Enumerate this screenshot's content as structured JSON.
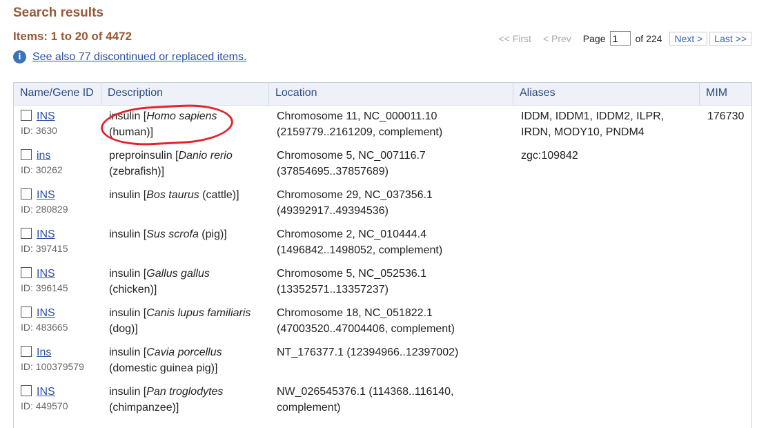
{
  "header": {
    "title": "Search results",
    "items_label": "Items: 1 to 20 of 4472"
  },
  "pager": {
    "first": "<< First",
    "prev": "< Prev",
    "page_label": "Page",
    "page_value": "1",
    "of_label": "of 224",
    "next": "Next >",
    "last": "Last >>"
  },
  "info": {
    "icon": "info-icon",
    "link_text": "See also 77 discontinued or replaced items."
  },
  "table": {
    "columns": [
      "Name/Gene ID",
      "Description",
      "Location",
      "Aliases",
      "MIM"
    ],
    "rows": [
      {
        "name": "INS",
        "id": "ID: 3630",
        "desc_pre": "insulin [",
        "desc_sp": "Homo sapiens",
        "desc_post": "",
        "desc_line2": "(human)]",
        "loc1": "Chromosome 11, NC_000011.10",
        "loc2": "(2159779..2161209, complement)",
        "alias1": "IDDM, IDDM1, IDDM2, ILPR,",
        "alias2": "IRDN, MODY10, PNDM4",
        "mim": "176730"
      },
      {
        "name": "ins",
        "id": "ID: 30262",
        "desc_pre": "preproinsulin [",
        "desc_sp": "Danio rerio",
        "desc_post": "",
        "desc_line2": "(zebrafish)]",
        "loc1": "Chromosome 5, NC_007116.7",
        "loc2": "(37854695..37857689)",
        "alias1": "zgc:109842",
        "alias2": "",
        "mim": ""
      },
      {
        "name": "INS",
        "id": "ID: 280829",
        "desc_pre": "insulin [",
        "desc_sp": "Bos taurus",
        "desc_post": " (cattle)]",
        "desc_line2": "",
        "loc1": "Chromosome 29, NC_037356.1",
        "loc2": "(49392917..49394536)",
        "alias1": "",
        "alias2": "",
        "mim": ""
      },
      {
        "name": "INS",
        "id": "ID: 397415",
        "desc_pre": "insulin [",
        "desc_sp": "Sus scrofa",
        "desc_post": " (pig)]",
        "desc_line2": "",
        "loc1": "Chromosome 2, NC_010444.4",
        "loc2": "(1496842..1498052, complement)",
        "alias1": "",
        "alias2": "",
        "mim": ""
      },
      {
        "name": "INS",
        "id": "ID: 396145",
        "desc_pre": "insulin [",
        "desc_sp": "Gallus gallus",
        "desc_post": "",
        "desc_line2": "(chicken)]",
        "loc1": "Chromosome 5, NC_052536.1",
        "loc2": "(13352571..13357237)",
        "alias1": "",
        "alias2": "",
        "mim": ""
      },
      {
        "name": "INS",
        "id": "ID: 483665",
        "desc_pre": "insulin [",
        "desc_sp": "Canis lupus familiaris",
        "desc_post": "",
        "desc_line2": "(dog)]",
        "loc1": "Chromosome 18, NC_051822.1",
        "loc2": "(47003520..47004406, complement)",
        "alias1": "",
        "alias2": "",
        "mim": ""
      },
      {
        "name": "Ins",
        "id": "ID: 100379579",
        "desc_pre": "insulin [",
        "desc_sp": "Cavia porcellus",
        "desc_post": "",
        "desc_line2": "(domestic guinea pig)]",
        "loc1": "NT_176377.1 (12394966..12397002)",
        "loc2": "",
        "alias1": "",
        "alias2": "",
        "mim": ""
      },
      {
        "name": "INS",
        "id": "ID: 449570",
        "desc_pre": "insulin [",
        "desc_sp": "Pan troglodytes",
        "desc_post": "",
        "desc_line2": "(chimpanzee)]",
        "loc1": "NW_026545376.1 (114368..116140,",
        "loc2": "complement)",
        "alias1": "",
        "alias2": "",
        "mim": ""
      }
    ]
  }
}
